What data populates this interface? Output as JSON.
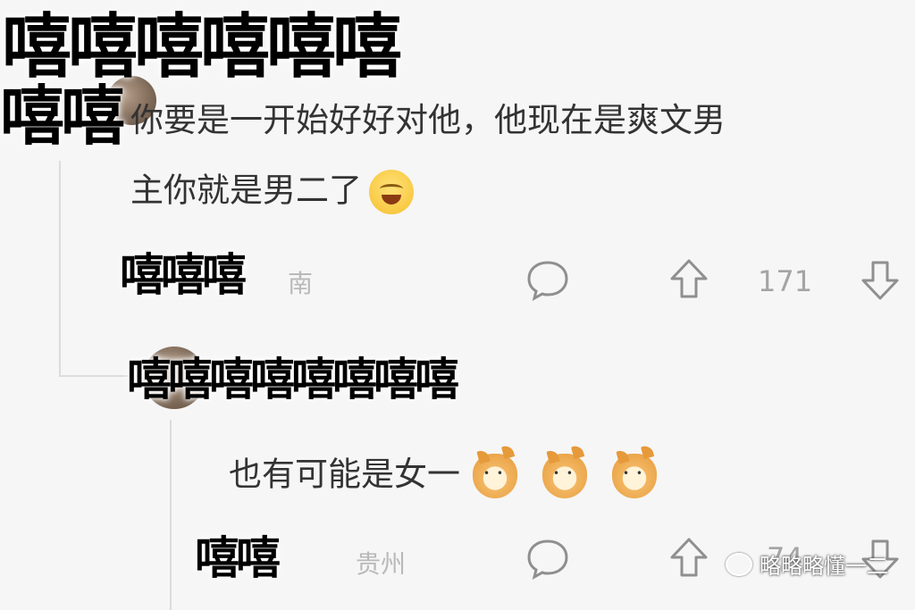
{
  "comments": [
    {
      "username": "嘻嘻嘻嘻嘻嘻",
      "username_line2": "嘻嘻",
      "text_line1": "你要是一开始好好对他，他现在是爽文男",
      "text_line2": "主你就是男二了",
      "user_tag": "嘻嘻嘻",
      "location": "南",
      "likes": "171",
      "emoji": "smile-emoji"
    },
    {
      "username": "嘻嘻嘻嘻嘻嘻嘻嘻",
      "text": "也有可能是女一",
      "user_tag": "嘻嘻",
      "location": "贵州",
      "likes": "74",
      "emoji": "doge-emoji"
    }
  ],
  "watermark": {
    "text": "略略略懂一二"
  },
  "colors": {
    "background": "#f6f6f6",
    "text": "#333333",
    "meta": "#b9b9b9",
    "icon": "#8f8f8f"
  }
}
